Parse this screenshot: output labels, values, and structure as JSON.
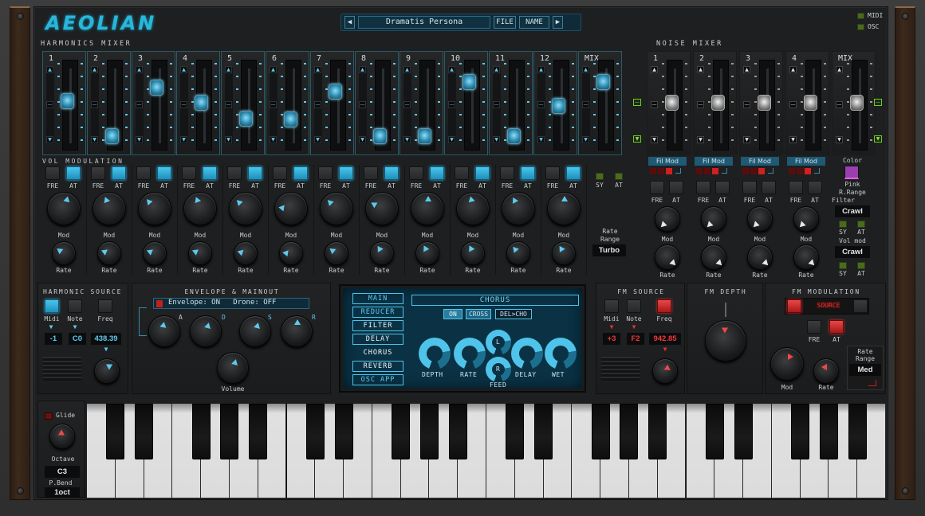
{
  "app": {
    "logo": "AEOLIAN"
  },
  "header": {
    "preset_name": "Dramatis Persona",
    "prev_icon": "triangle-left-icon",
    "next_icon": "triangle-right-icon",
    "file_label": "FILE",
    "name_label": "NAME",
    "midi_label": "MIDI",
    "osc_label": "OSC"
  },
  "harmonics_mixer": {
    "title": "HARMONICS MIXER",
    "channels": [
      {
        "label": "1",
        "level": 0.52
      },
      {
        "label": "2",
        "level": 0.02
      },
      {
        "label": "3",
        "level": 0.72
      },
      {
        "label": "4",
        "level": 0.5
      },
      {
        "label": "5",
        "level": 0.27
      },
      {
        "label": "6",
        "level": 0.26
      },
      {
        "label": "7",
        "level": 0.66
      },
      {
        "label": "8",
        "level": 0.02
      },
      {
        "label": "9",
        "level": 0.02
      },
      {
        "label": "10",
        "level": 0.79
      },
      {
        "label": "11",
        "level": 0.02
      },
      {
        "label": "12",
        "level": 0.45
      },
      {
        "label": "MIX",
        "level": 0.79
      }
    ]
  },
  "noise_mixer": {
    "title": "NOISE MIXER",
    "channels": [
      {
        "label": "1",
        "level": 0.5
      },
      {
        "label": "2",
        "level": 0.5
      },
      {
        "label": "3",
        "level": 0.5
      },
      {
        "label": "4",
        "level": 0.5
      },
      {
        "label": "MIX",
        "level": 0.5
      }
    ],
    "fil_mod_label": "Fil Mod",
    "color_label": "Color",
    "color_value": "Pink",
    "color_swatch": "#9b3fb0",
    "rrange_label": "R.Range",
    "filter_label": "Filter",
    "filter_value": "Crawl",
    "volmod_label": "Vol mod",
    "volmod_value": "Crawl",
    "sy_label": "SY",
    "at_label": "AT",
    "fre_label": "FRE",
    "mod_label": "Mod",
    "rate_label": "Rate"
  },
  "vol_modulation": {
    "title": "VOL MODULATION",
    "fre_label": "FRE",
    "at_label": "AT",
    "mod_label": "Mod",
    "rate_label": "Rate",
    "sy_label": "SY",
    "rate_range_label": "Rate Range",
    "rate_range_value": "Turbo",
    "channels": [
      {
        "fre": false,
        "at": true,
        "mod": 0.55,
        "rate": 0.3
      },
      {
        "fre": false,
        "at": true,
        "mod": 0.42,
        "rate": 0.25
      },
      {
        "fre": false,
        "at": true,
        "mod": 0.35,
        "rate": 0.25
      },
      {
        "fre": false,
        "at": true,
        "mod": 0.42,
        "rate": 0.25
      },
      {
        "fre": false,
        "at": true,
        "mod": 0.33,
        "rate": 0.23
      },
      {
        "fre": false,
        "at": true,
        "mod": 0.2,
        "rate": 0.2
      },
      {
        "fre": false,
        "at": true,
        "mod": 0.33,
        "rate": 0.3
      },
      {
        "fre": false,
        "at": true,
        "mod": 0.28,
        "rate": 0.38
      },
      {
        "fre": false,
        "at": true,
        "mod": 0.5,
        "rate": 0.4
      },
      {
        "fre": false,
        "at": true,
        "mod": 0.45,
        "rate": 0.4
      },
      {
        "fre": false,
        "at": true,
        "mod": 0.4,
        "rate": 0.35
      },
      {
        "fre": false,
        "at": true,
        "mod": 0.5,
        "rate": 0.38
      }
    ]
  },
  "harmonic_source": {
    "title": "HARMONIC SOURCE",
    "midi_label": "Midi",
    "note_label": "Note",
    "freq_label": "Freq",
    "midi_value": "-1",
    "note_value": "C0",
    "freq_value": "438.39",
    "midi_on": true
  },
  "envelope": {
    "title": "ENVELOPE & MAINOUT",
    "status": "Envelope: ON   Drone: OFF",
    "a_label": "A",
    "d_label": "D",
    "s_label": "S",
    "r_label": "R",
    "volume_label": "Volume"
  },
  "fx_screen": {
    "tabs": [
      "MAIN",
      "REDUCER",
      "FILTER",
      "DELAY",
      "CHORUS",
      "REVERB",
      "OSC APP"
    ],
    "selected_tab": "CHORUS",
    "title": "CHORUS",
    "on_label": "ON",
    "cross_label": "CROSS",
    "delcho_label": "DEL>CHO",
    "knobs": [
      "DEPTH",
      "RATE",
      "DELAY",
      "WET"
    ],
    "l_label": "L",
    "r_label": "R",
    "feed_label": "FEED"
  },
  "fm_source": {
    "title": "FM SOURCE",
    "midi_label": "Midi",
    "note_label": "Note",
    "freq_label": "Freq",
    "midi_value": "+3",
    "note_value": "F2",
    "freq_value": "942.85",
    "freq_on": true
  },
  "fm_depth": {
    "title": "FM DEPTH"
  },
  "fm_modulation": {
    "title": "FM MODULATION",
    "source_label": "SOURCE",
    "fre_label": "FRE",
    "at_label": "AT",
    "mod_label": "Mod",
    "rate_label": "Rate",
    "rate_range_label": "Rate Range",
    "rate_range_value": "Med"
  },
  "keyboard_controls": {
    "glide_label": "Glide",
    "octave_label": "Octave",
    "octave_value": "C3",
    "pbend_label": "P.Bend",
    "pbend_value": "1oct"
  },
  "keyboard": {
    "white_keys": 28
  }
}
